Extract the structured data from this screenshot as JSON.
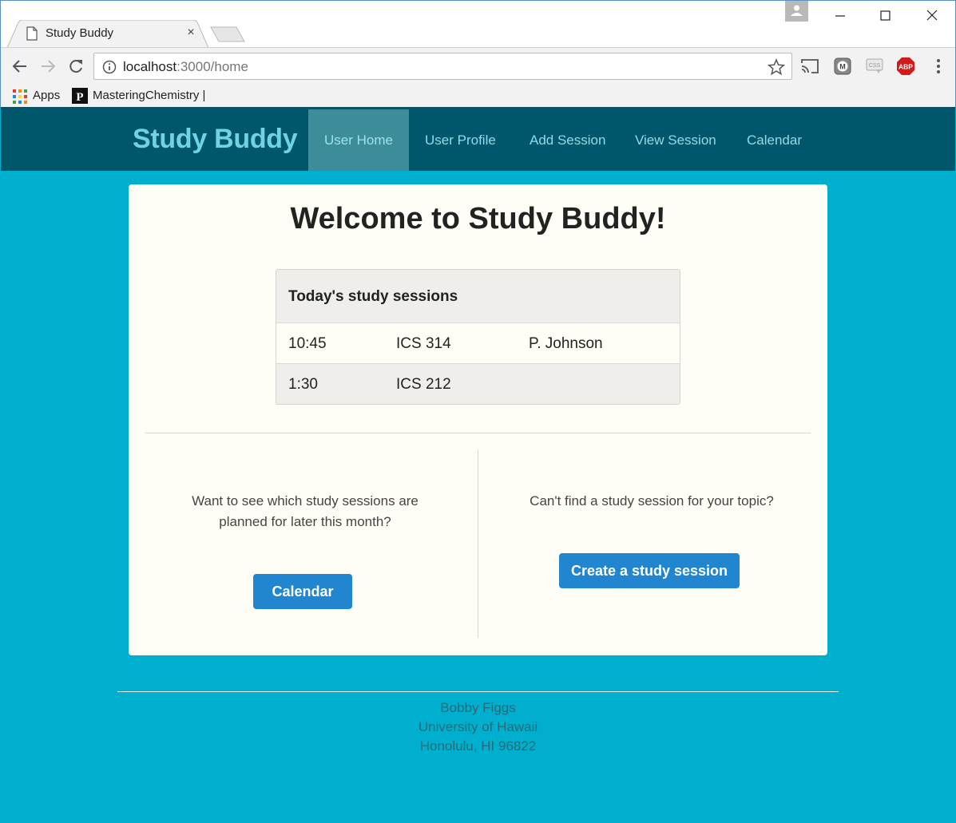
{
  "browser": {
    "tab_title": "Study Buddy",
    "tab_close": "×",
    "url_host": "localhost",
    "url_rest": ":3000/home",
    "bookmarks": [
      "Apps",
      "MasteringChemistry |"
    ],
    "extension_abp": "ABP",
    "extension_css": "CSS",
    "icons": [
      "back-icon",
      "forward-icon",
      "reload-icon",
      "info-icon",
      "star-icon",
      "cast-icon",
      "extension-icon",
      "css-icon",
      "adblock-icon",
      "menu-icon"
    ]
  },
  "navbar": {
    "brand": "Study Buddy",
    "items": [
      "User Home",
      "User Profile",
      "Add Session",
      "View Session",
      "Calendar"
    ],
    "active_index": 0
  },
  "main": {
    "title": "Welcome to Study Buddy!",
    "sessions": {
      "header": "Today's study sessions",
      "rows": [
        [
          "10:45",
          "ICS 314",
          "P. Johnson"
        ],
        [
          "1:30",
          "ICS 212",
          ""
        ]
      ]
    },
    "left_col": {
      "text_line1": "Want to see which study sessions are",
      "text_line2": "planned for later this month?",
      "button": "Calendar"
    },
    "right_col": {
      "text": "Can't find a study session for your topic?",
      "button": "Create a study session"
    }
  },
  "footer": {
    "lines": [
      "Bobby Figgs",
      "University of Hawaii",
      "Honolulu, HI 96822"
    ]
  },
  "colors": {
    "page_bg": "#00aecd",
    "navbar_bg": "#00576b",
    "brand": "#6fd3e0",
    "card_bg": "#fffef6",
    "button": "#2185d0"
  }
}
